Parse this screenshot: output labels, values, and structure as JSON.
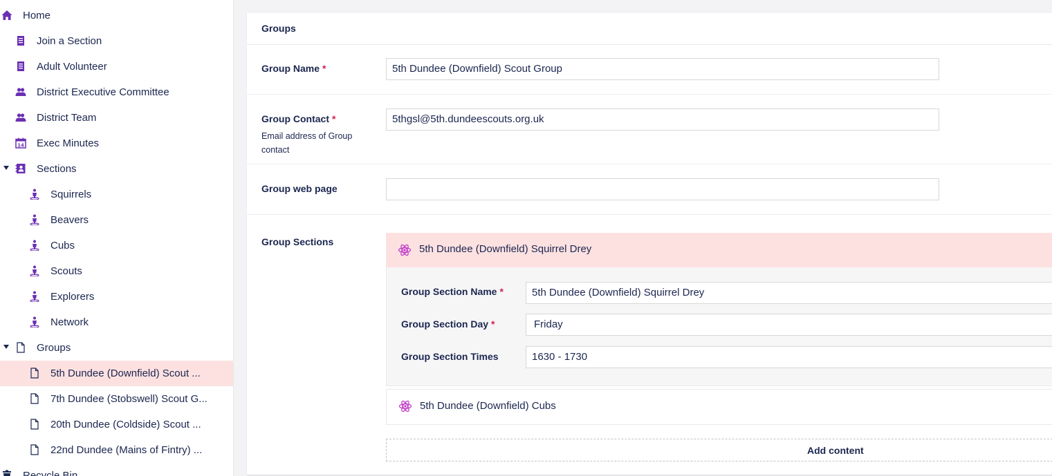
{
  "sidebar": {
    "items": [
      {
        "label": "Home",
        "icon": "home-icon"
      },
      {
        "label": "Join a Section",
        "icon": "document-list-icon"
      },
      {
        "label": "Adult Volunteer",
        "icon": "document-list-icon"
      },
      {
        "label": "District Executive Committee",
        "icon": "users-icon"
      },
      {
        "label": "District Team",
        "icon": "users-icon"
      },
      {
        "label": "Exec Minutes",
        "icon": "calendar-icon"
      },
      {
        "label": "Sections",
        "icon": "contact-book-icon"
      },
      {
        "label": "Squirrels",
        "icon": "person-icon"
      },
      {
        "label": "Beavers",
        "icon": "person-icon"
      },
      {
        "label": "Cubs",
        "icon": "person-icon"
      },
      {
        "label": "Scouts",
        "icon": "person-icon"
      },
      {
        "label": "Explorers",
        "icon": "person-icon"
      },
      {
        "label": "Network",
        "icon": "person-icon"
      },
      {
        "label": "Groups",
        "icon": "page-icon"
      },
      {
        "label": "5th Dundee (Downfield) Scout ...",
        "icon": "page-icon"
      },
      {
        "label": "7th Dundee (Stobswell) Scout G...",
        "icon": "page-icon"
      },
      {
        "label": "20th Dundee (Coldside) Scout ...",
        "icon": "page-icon"
      },
      {
        "label": "22nd Dundee (Mains of Fintry) ...",
        "icon": "page-icon"
      },
      {
        "label": "Recycle Bin",
        "icon": "trash-icon"
      }
    ]
  },
  "panel": {
    "title": "Groups",
    "group_name": {
      "label": "Group Name",
      "required": "*",
      "value": "5th Dundee (Downfield) Scout Group"
    },
    "group_contact": {
      "label": "Group Contact",
      "required": "*",
      "description": "Email address of Group contact",
      "value": "5thgsl@5th.dundeescouts.org.uk"
    },
    "group_web_page": {
      "label": "Group web page",
      "value": ""
    },
    "group_sections": {
      "label": "Group Sections",
      "blocks": [
        {
          "title": "5th Dundee (Downfield) Squirrel Drey",
          "fields": {
            "name": {
              "label": "Group Section Name",
              "required": "*",
              "value": "5th Dundee (Downfield) Squirrel Drey"
            },
            "day": {
              "label": "Group Section Day",
              "required": "*",
              "value": "Friday"
            },
            "times": {
              "label": "Group Section Times",
              "value": "1630 - 1730"
            }
          }
        },
        {
          "title": "5th Dundee (Downfield) Cubs"
        }
      ],
      "add_content": "Add content"
    }
  },
  "colors": {
    "icon_purple": "#6b2fb3",
    "active_row": "#fde1e1",
    "required": "#d42054",
    "text": "#1b264f",
    "block_icon": "#c13ec9"
  }
}
